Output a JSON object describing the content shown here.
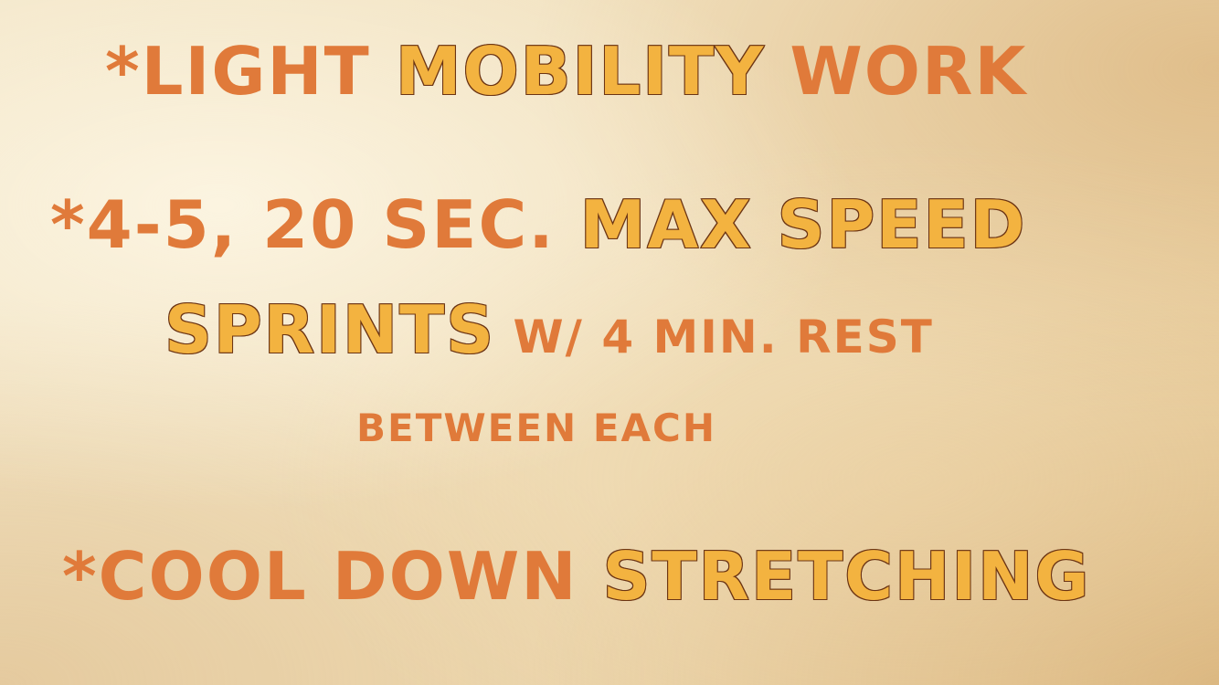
{
  "line1": {
    "plain": "*Light ",
    "highlight": "Mobility",
    "plain2": " Work"
  },
  "line2": {
    "plain": "*4-5, 20 sec. ",
    "highlight": "Max Speed"
  },
  "line3": {
    "highlight": "Sprints",
    "plain": " w/ 4 min. Rest"
  },
  "line4": {
    "plain": "between each"
  },
  "line5": {
    "plain": "*Cool Down ",
    "highlight": "Stretching"
  },
  "colors": {
    "plain_text": "#e07a3a",
    "highlight_fill": "#f3b340",
    "highlight_outline": "#6b3414",
    "background": "#f1e0bd"
  }
}
